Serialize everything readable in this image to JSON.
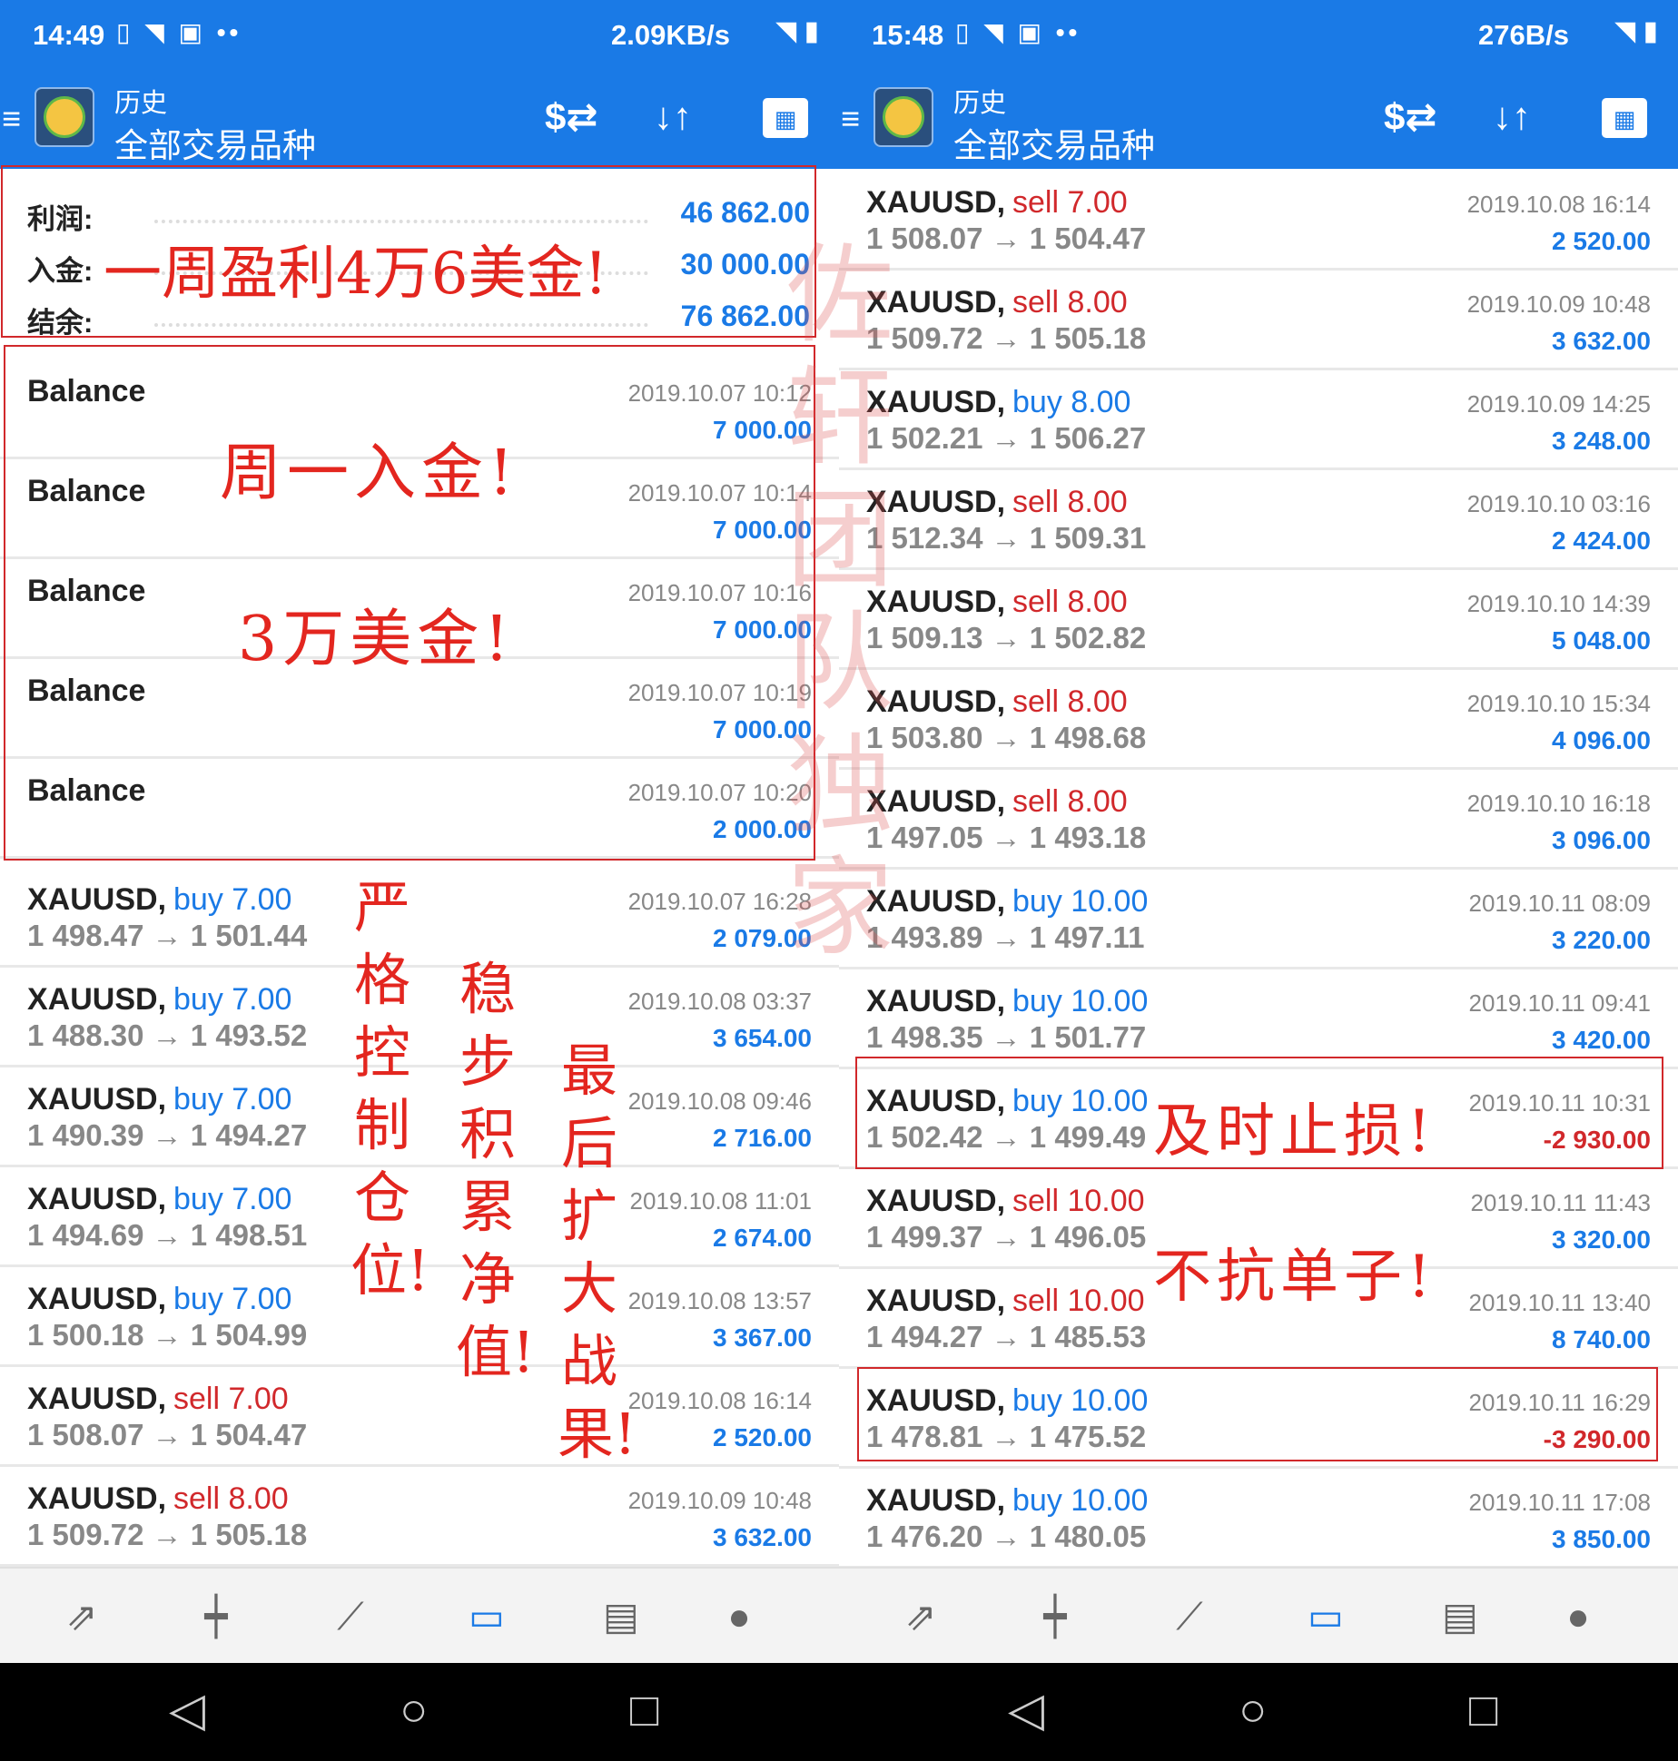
{
  "left": {
    "status": {
      "time": "14:49",
      "speed": "2.09KB/s"
    },
    "appbar": {
      "title": "历史",
      "subtitle": "全部交易品种"
    },
    "summary": [
      {
        "label": "利润:",
        "value": "46 862.00"
      },
      {
        "label": "入金:",
        "value": "30 000.00"
      },
      {
        "label": "结余:",
        "value": "76 862.00"
      }
    ],
    "balance": [
      {
        "label": "Balance",
        "time": "2019.10.07 10:12",
        "amount": "7 000.00"
      },
      {
        "label": "Balance",
        "time": "2019.10.07 10:14",
        "amount": "7 000.00"
      },
      {
        "label": "Balance",
        "time": "2019.10.07 10:16",
        "amount": "7 000.00"
      },
      {
        "label": "Balance",
        "time": "2019.10.07 10:19",
        "amount": "7 000.00"
      },
      {
        "label": "Balance",
        "time": "2019.10.07 10:20",
        "amount": "2 000.00"
      }
    ],
    "trades": [
      {
        "symbol": "XAUUSD,",
        "type": "buy 7.00",
        "dir": "buy",
        "prices": "1 498.47 → 1 501.44",
        "time": "2019.10.07 16:28",
        "profit": "2 079.00",
        "neg": false
      },
      {
        "symbol": "XAUUSD,",
        "type": "buy 7.00",
        "dir": "buy",
        "prices": "1 488.30 → 1 493.52",
        "time": "2019.10.08 03:37",
        "profit": "3 654.00",
        "neg": false
      },
      {
        "symbol": "XAUUSD,",
        "type": "buy 7.00",
        "dir": "buy",
        "prices": "1 490.39 → 1 494.27",
        "time": "2019.10.08 09:46",
        "profit": "2 716.00",
        "neg": false
      },
      {
        "symbol": "XAUUSD,",
        "type": "buy 7.00",
        "dir": "buy",
        "prices": "1 494.69 → 1 498.51",
        "time": "2019.10.08 11:01",
        "profit": "2 674.00",
        "neg": false
      },
      {
        "symbol": "XAUUSD,",
        "type": "buy 7.00",
        "dir": "buy",
        "prices": "1 500.18 → 1 504.99",
        "time": "2019.10.08 13:57",
        "profit": "3 367.00",
        "neg": false
      },
      {
        "symbol": "XAUUSD,",
        "type": "sell 7.00",
        "dir": "sell",
        "prices": "1 508.07 → 1 504.47",
        "time": "2019.10.08 16:14",
        "profit": "2 520.00",
        "neg": false
      },
      {
        "symbol": "XAUUSD,",
        "type": "sell 8.00",
        "dir": "sell",
        "prices": "1 509.72 → 1 505.18",
        "time": "2019.10.09 10:48",
        "profit": "3 632.00",
        "neg": false
      }
    ],
    "annotations": {
      "banner": "一周盈利4万6美金!",
      "deposit1": "周一入金!",
      "deposit2": "3万美金!",
      "v1": "严格控制仓位!",
      "v2": "稳步积累净值!",
      "v3": "最后扩大战果!"
    }
  },
  "right": {
    "status": {
      "time": "15:48",
      "speed": "276B/s"
    },
    "appbar": {
      "title": "历史",
      "subtitle": "全部交易品种"
    },
    "trades": [
      {
        "symbol": "XAUUSD,",
        "type": "sell 7.00",
        "dir": "sell",
        "prices": "1 508.07 → 1 504.47",
        "time": "2019.10.08 16:14",
        "profit": "2 520.00",
        "neg": false
      },
      {
        "symbol": "XAUUSD,",
        "type": "sell 8.00",
        "dir": "sell",
        "prices": "1 509.72 → 1 505.18",
        "time": "2019.10.09 10:48",
        "profit": "3 632.00",
        "neg": false
      },
      {
        "symbol": "XAUUSD,",
        "type": "buy 8.00",
        "dir": "buy",
        "prices": "1 502.21 → 1 506.27",
        "time": "2019.10.09 14:25",
        "profit": "3 248.00",
        "neg": false
      },
      {
        "symbol": "XAUUSD,",
        "type": "sell 8.00",
        "dir": "sell",
        "prices": "1 512.34 → 1 509.31",
        "time": "2019.10.10 03:16",
        "profit": "2 424.00",
        "neg": false
      },
      {
        "symbol": "XAUUSD,",
        "type": "sell 8.00",
        "dir": "sell",
        "prices": "1 509.13 → 1 502.82",
        "time": "2019.10.10 14:39",
        "profit": "5 048.00",
        "neg": false
      },
      {
        "symbol": "XAUUSD,",
        "type": "sell 8.00",
        "dir": "sell",
        "prices": "1 503.80 → 1 498.68",
        "time": "2019.10.10 15:34",
        "profit": "4 096.00",
        "neg": false
      },
      {
        "symbol": "XAUUSD,",
        "type": "sell 8.00",
        "dir": "sell",
        "prices": "1 497.05 → 1 493.18",
        "time": "2019.10.10 16:18",
        "profit": "3 096.00",
        "neg": false
      },
      {
        "symbol": "XAUUSD,",
        "type": "buy 10.00",
        "dir": "buy",
        "prices": "1 493.89 → 1 497.11",
        "time": "2019.10.11 08:09",
        "profit": "3 220.00",
        "neg": false
      },
      {
        "symbol": "XAUUSD,",
        "type": "buy 10.00",
        "dir": "buy",
        "prices": "1 498.35 → 1 501.77",
        "time": "2019.10.11 09:41",
        "profit": "3 420.00",
        "neg": false
      },
      {
        "symbol": "XAUUSD,",
        "type": "buy 10.00",
        "dir": "buy",
        "prices": "1 502.42 → 1 499.49",
        "time": "2019.10.11 10:31",
        "profit": "-2 930.00",
        "neg": true
      },
      {
        "symbol": "XAUUSD,",
        "type": "sell 10.00",
        "dir": "sell",
        "prices": "1 499.37 → 1 496.05",
        "time": "2019.10.11 11:43",
        "profit": "3 320.00",
        "neg": false
      },
      {
        "symbol": "XAUUSD,",
        "type": "sell 10.00",
        "dir": "sell",
        "prices": "1 494.27 → 1 485.53",
        "time": "2019.10.11 13:40",
        "profit": "8 740.00",
        "neg": false
      },
      {
        "symbol": "XAUUSD,",
        "type": "buy 10.00",
        "dir": "buy",
        "prices": "1 478.81 → 1 475.52",
        "time": "2019.10.11 16:29",
        "profit": "-3 290.00",
        "neg": true
      },
      {
        "symbol": "XAUUSD,",
        "type": "buy 10.00",
        "dir": "buy",
        "prices": "1 476.20 → 1 480.05",
        "time": "2019.10.11 17:08",
        "profit": "3 850.00",
        "neg": false
      }
    ],
    "annotations": {
      "stoploss": "及时止损!",
      "nohold": "不抗单子!"
    }
  },
  "watermark": "佐轩团队独家",
  "icons": {
    "toolbar": [
      "currency-exchange-icon",
      "sort-icon",
      "calendar-icon"
    ],
    "bottom": [
      "trade-icon",
      "quotes-icon",
      "chart-icon",
      "history-icon",
      "news-icon",
      "chat-icon"
    ],
    "nav": [
      "back-icon",
      "home-icon",
      "recents-icon"
    ]
  },
  "colors": {
    "primary": "#1a7ae6",
    "loss": "#d1282b",
    "annotation": "#e3261f"
  }
}
